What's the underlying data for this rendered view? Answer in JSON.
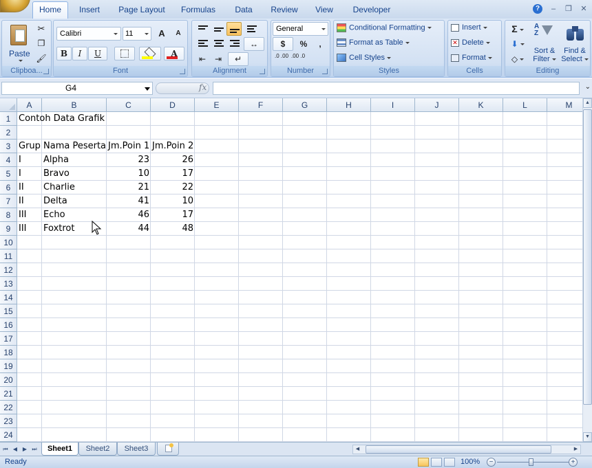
{
  "ribbon_tabs": [
    "Home",
    "Insert",
    "Page Layout",
    "Formulas",
    "Data",
    "Review",
    "View",
    "Developer"
  ],
  "window": {
    "help": "?",
    "minimize": "–",
    "restore": "❐",
    "close": "✕"
  },
  "clipboard": {
    "paste_label": "Paste",
    "group_label": "Clipboa..."
  },
  "font": {
    "name": "Calibri",
    "size": "11",
    "grow": "A",
    "shrink": "A",
    "bold": "B",
    "italic": "I",
    "underline": "U",
    "color_letter": "A",
    "group_label": "Font"
  },
  "alignment": {
    "group_label": "Alignment"
  },
  "number": {
    "format": "General",
    "currency": "$",
    "percent": "%",
    "comma": ",",
    "inc_decimal": ".0 .00",
    "dec_decimal": ".00 .0",
    "group_label": "Number"
  },
  "styles": {
    "conditional": "Conditional Formatting",
    "format_table": "Format as Table",
    "cell_styles": "Cell Styles",
    "group_label": "Styles"
  },
  "cells_group": {
    "insert": "Insert",
    "delete": "Delete",
    "format": "Format",
    "group_label": "Cells"
  },
  "editing": {
    "sigma": "Σ",
    "sort_filter_1": "Sort &",
    "sort_filter_2": "Filter",
    "find_select_1": "Find &",
    "find_select_2": "Select",
    "group_label": "Editing"
  },
  "formula_bar": {
    "name_box": "G4",
    "fx": "fx",
    "value": ""
  },
  "columns": [
    "A",
    "B",
    "C",
    "D",
    "E",
    "F",
    "G",
    "H",
    "I",
    "J",
    "K",
    "L",
    "M"
  ],
  "rows": [
    "1",
    "2",
    "3",
    "4",
    "5",
    "6",
    "7",
    "8",
    "9",
    "10",
    "11",
    "12",
    "13",
    "14",
    "15",
    "16",
    "17",
    "18",
    "19",
    "20",
    "21",
    "22",
    "23",
    "24"
  ],
  "cells": {
    "r1": {
      "A": "Contoh Data Grafik"
    },
    "r3": {
      "A": "Grup",
      "B": "Nama Peserta",
      "C": "Jm.Poin 1",
      "D": "Jm.Poin 2"
    },
    "data": [
      {
        "A": "I",
        "B": "Alpha",
        "C": "23",
        "D": "26"
      },
      {
        "A": "I",
        "B": "Bravo",
        "C": "10",
        "D": "17"
      },
      {
        "A": "II",
        "B": "Charlie",
        "C": "21",
        "D": "22"
      },
      {
        "A": "II",
        "B": "Delta",
        "C": "41",
        "D": "10"
      },
      {
        "A": "III",
        "B": "Echo",
        "C": "46",
        "D": "17"
      },
      {
        "A": "III",
        "B": "Foxtrot",
        "C": "44",
        "D": "48"
      }
    ]
  },
  "sheets": [
    "Sheet1",
    "Sheet2",
    "Sheet3"
  ],
  "active_sheet": "Sheet1",
  "status": {
    "ready": "Ready",
    "zoom": "100%",
    "zoom_out": "−",
    "zoom_in": "+"
  },
  "colors": {
    "accent": "#15428b",
    "ribbon": "#c4d6ee",
    "grid": "#d0d7e5",
    "active_button": "#f9c25f"
  }
}
